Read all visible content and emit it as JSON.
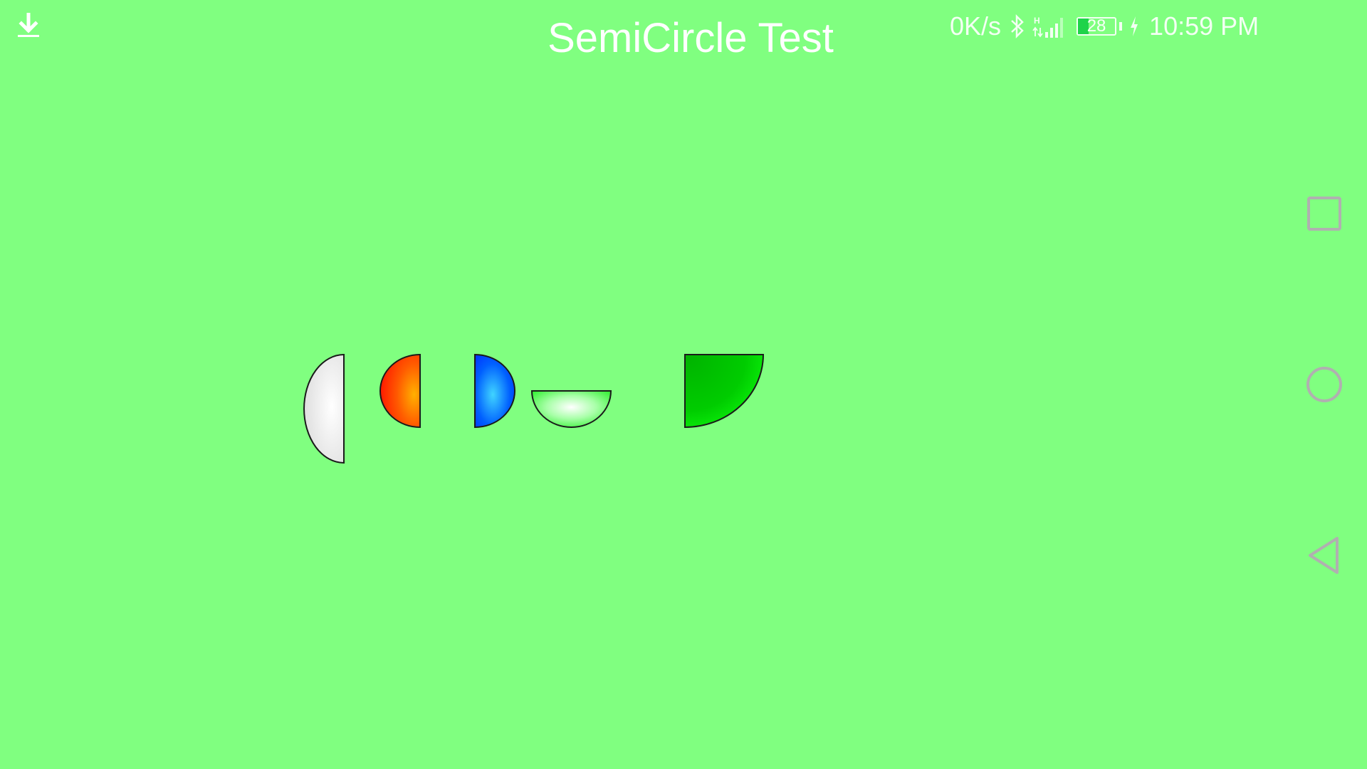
{
  "app": {
    "title": "SemiCircle Test"
  },
  "status_bar": {
    "net_speed": "0K/s",
    "battery_level": "28",
    "battery_fraction": 0.28,
    "time": "10:59 PM",
    "icons": [
      "download-icon",
      "bluetooth-icon",
      "signal-icon",
      "battery-icon",
      "charging-icon"
    ]
  },
  "semicircles": [
    {
      "name": "white-left-half",
      "orientation": "left",
      "color": "#dcdcdc",
      "highlight": "#ffffff"
    },
    {
      "name": "red-left-half",
      "orientation": "left",
      "color": "#ff2a00",
      "highlight": "#ff9a00"
    },
    {
      "name": "blue-right-half",
      "orientation": "right",
      "color": "#0030ff",
      "highlight": "#3fc8ff"
    },
    {
      "name": "light-green-bottom-half",
      "orientation": "bottom",
      "color": "#2cf22c",
      "highlight": "#ffffff"
    },
    {
      "name": "green-quarter",
      "orientation": "quarter",
      "color": "#00c000",
      "highlight": "#00ff00"
    }
  ],
  "colors": {
    "background": "#80ff80",
    "nav_icon": "#b0b0b0",
    "title": "#ffffff"
  },
  "nav_bar": {
    "buttons": [
      "recent-apps-icon",
      "home-icon",
      "back-icon"
    ]
  }
}
